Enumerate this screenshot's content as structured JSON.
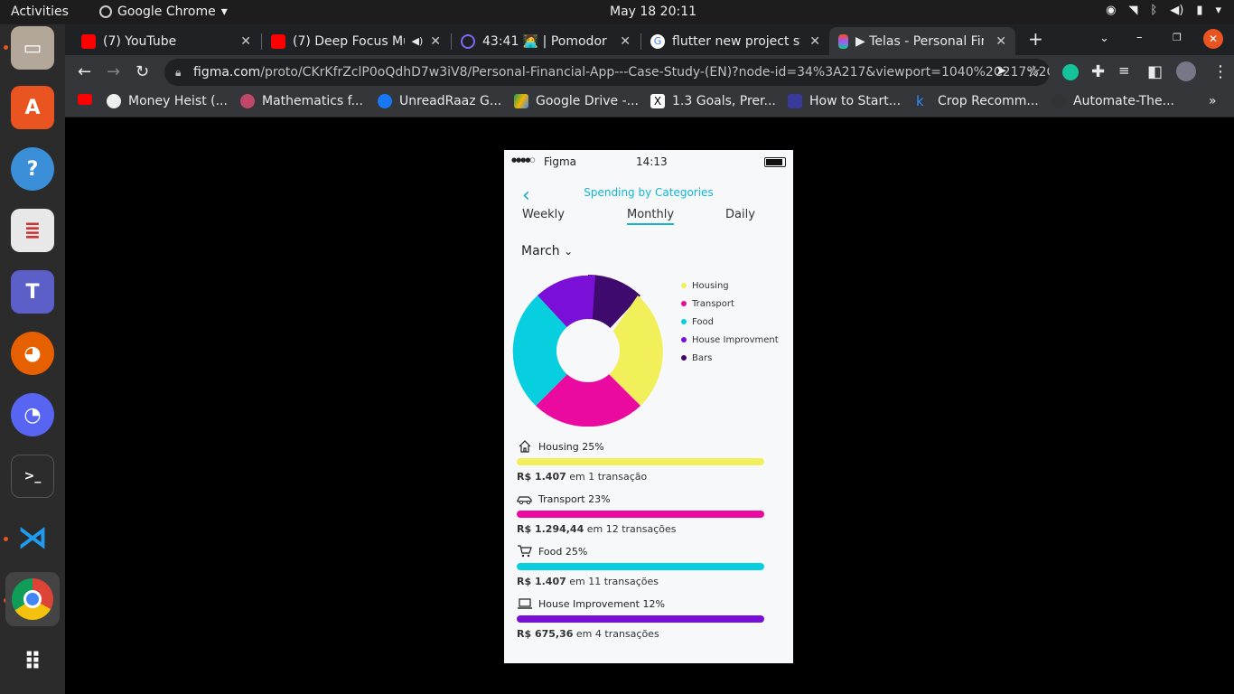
{
  "os": {
    "activities": "Activities",
    "app_name": "Google Chrome",
    "clock": "May 18  20:11"
  },
  "tabs": [
    {
      "title": "(7) YouTube"
    },
    {
      "title": "(7) Deep Focus Mu"
    },
    {
      "title": "43:41 🧑‍💻 | Pomodor"
    },
    {
      "title": "flutter new project st"
    },
    {
      "title": "▶ Telas - Personal Fin"
    }
  ],
  "toolbar": {
    "url_host": "figma.com",
    "url_path": "/proto/CKrKfrZclP0oQdhD7w3iV8/Personal-Financial-App---Case-Study-(EN)?node-id=34%3A217&viewport=1040%2C217%2C..."
  },
  "bookmarks": [
    {
      "label": "Money Heist (..."
    },
    {
      "label": "Mathematics f..."
    },
    {
      "label": "UnreadRaaz G..."
    },
    {
      "label": "Google Drive -..."
    },
    {
      "label": "1.3 Goals, Prer..."
    },
    {
      "label": "How to Start..."
    },
    {
      "label": "Crop Recomm..."
    },
    {
      "label": "Automate-The..."
    }
  ],
  "phone": {
    "carrier": "Figma",
    "time": "14:13",
    "title": "Spending by Categories",
    "tabs": [
      "Weekly",
      "Monthly",
      "Daily"
    ],
    "month": "March",
    "legend": [
      {
        "label": "Housing",
        "color": "#f2f05a"
      },
      {
        "label": "Transport",
        "color": "#ea0aa0"
      },
      {
        "label": "Food",
        "color": "#07cfe0"
      },
      {
        "label": "House Improvment",
        "color": "#7a0fd8"
      },
      {
        "label": "Bars",
        "color": "#3f0a6e"
      }
    ],
    "categories": [
      {
        "label": "Housing 25%",
        "amount": "R$ 1.407",
        "suffix": " em 1 transação",
        "color": "#f2f05a"
      },
      {
        "label": "Transport 23%",
        "amount": "R$ 1.294,44",
        "suffix": " em 12 transações",
        "color": "#ea0aa0"
      },
      {
        "label": "Food 25%",
        "amount": "R$ 1.407",
        "suffix": " em 11 transações",
        "color": "#07cfe0"
      },
      {
        "label": "House Improvement 12%",
        "amount": "R$ 675,36",
        "suffix": " em 4 transações",
        "color": "#7a0fd8"
      }
    ]
  }
}
